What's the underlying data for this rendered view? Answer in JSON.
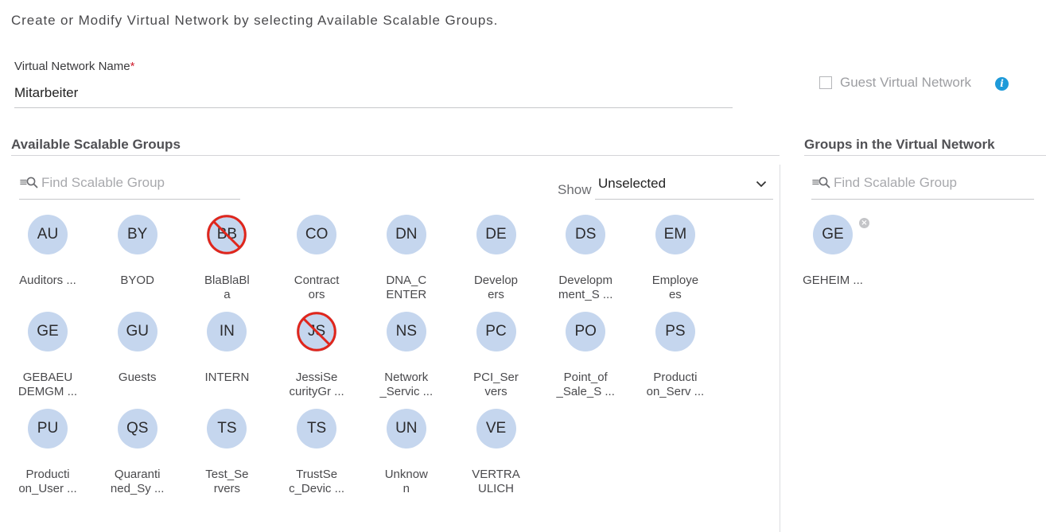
{
  "intro": "Create or Modify Virtual Network by selecting Available Scalable Groups.",
  "virtual_network": {
    "label": "Virtual Network Name",
    "required_mark": "*",
    "value": "Mitarbeiter"
  },
  "guest": {
    "label": "Guest Virtual Network",
    "checked": false
  },
  "icons": {
    "info": "info-icon",
    "search": "search-icon",
    "dropdown": "chevron-down-icon",
    "remove": "remove-icon",
    "disabled": "not-allowed-icon"
  },
  "colors": {
    "circle": "#c5d6ee",
    "disabled_strike": "#e0261c",
    "info": "#1e9ad9"
  },
  "available": {
    "title": "Available Scalable Groups",
    "search_placeholder": "Find Scalable Group",
    "show_label": "Show",
    "show_value": "Unselected",
    "groups": [
      {
        "abbr": "AU",
        "name": "Auditors ...",
        "disabled": false
      },
      {
        "abbr": "BY",
        "name": "BYOD",
        "disabled": false
      },
      {
        "abbr": "BB",
        "name": "BlaBlaBl\na",
        "disabled": true
      },
      {
        "abbr": "CO",
        "name": "Contract\nors",
        "disabled": false
      },
      {
        "abbr": "DN",
        "name": "DNA_C\nENTER",
        "disabled": false
      },
      {
        "abbr": "DE",
        "name": "Develop\ners",
        "disabled": false
      },
      {
        "abbr": "DS",
        "name": "Developm\nment_S ...",
        "disabled": false
      },
      {
        "abbr": "EM",
        "name": "Employe\nes",
        "disabled": false
      },
      {
        "abbr": "GE",
        "name": "GEBAEU\nDEMGM ...",
        "disabled": false
      },
      {
        "abbr": "GU",
        "name": "Guests",
        "disabled": false
      },
      {
        "abbr": "IN",
        "name": "INTERN",
        "disabled": false
      },
      {
        "abbr": "JS",
        "name": "JessiSe\ncurityGr ...",
        "disabled": true
      },
      {
        "abbr": "NS",
        "name": "Network\n_Servic ...",
        "disabled": false
      },
      {
        "abbr": "PC",
        "name": "PCI_Ser\nvers",
        "disabled": false
      },
      {
        "abbr": "PO",
        "name": "Point_of\n_Sale_S ...",
        "disabled": false
      },
      {
        "abbr": "PS",
        "name": "Producti\non_Serv ...",
        "disabled": false
      },
      {
        "abbr": "PU",
        "name": "Producti\non_User ...",
        "disabled": false
      },
      {
        "abbr": "QS",
        "name": "Quaranti\nned_Sy ...",
        "disabled": false
      },
      {
        "abbr": "TS",
        "name": "Test_Se\nrvers",
        "disabled": false
      },
      {
        "abbr": "TS",
        "name": "TrustSe\nc_Devic ...",
        "disabled": false
      },
      {
        "abbr": "UN",
        "name": "Unknow\nn",
        "disabled": false
      },
      {
        "abbr": "VE",
        "name": "VERTRA\nULICH",
        "disabled": false
      }
    ]
  },
  "selected": {
    "title": "Groups in the Virtual Network",
    "search_placeholder": "Find Scalable Group",
    "groups": [
      {
        "abbr": "GE",
        "name": "GEHEIM ..."
      }
    ]
  }
}
